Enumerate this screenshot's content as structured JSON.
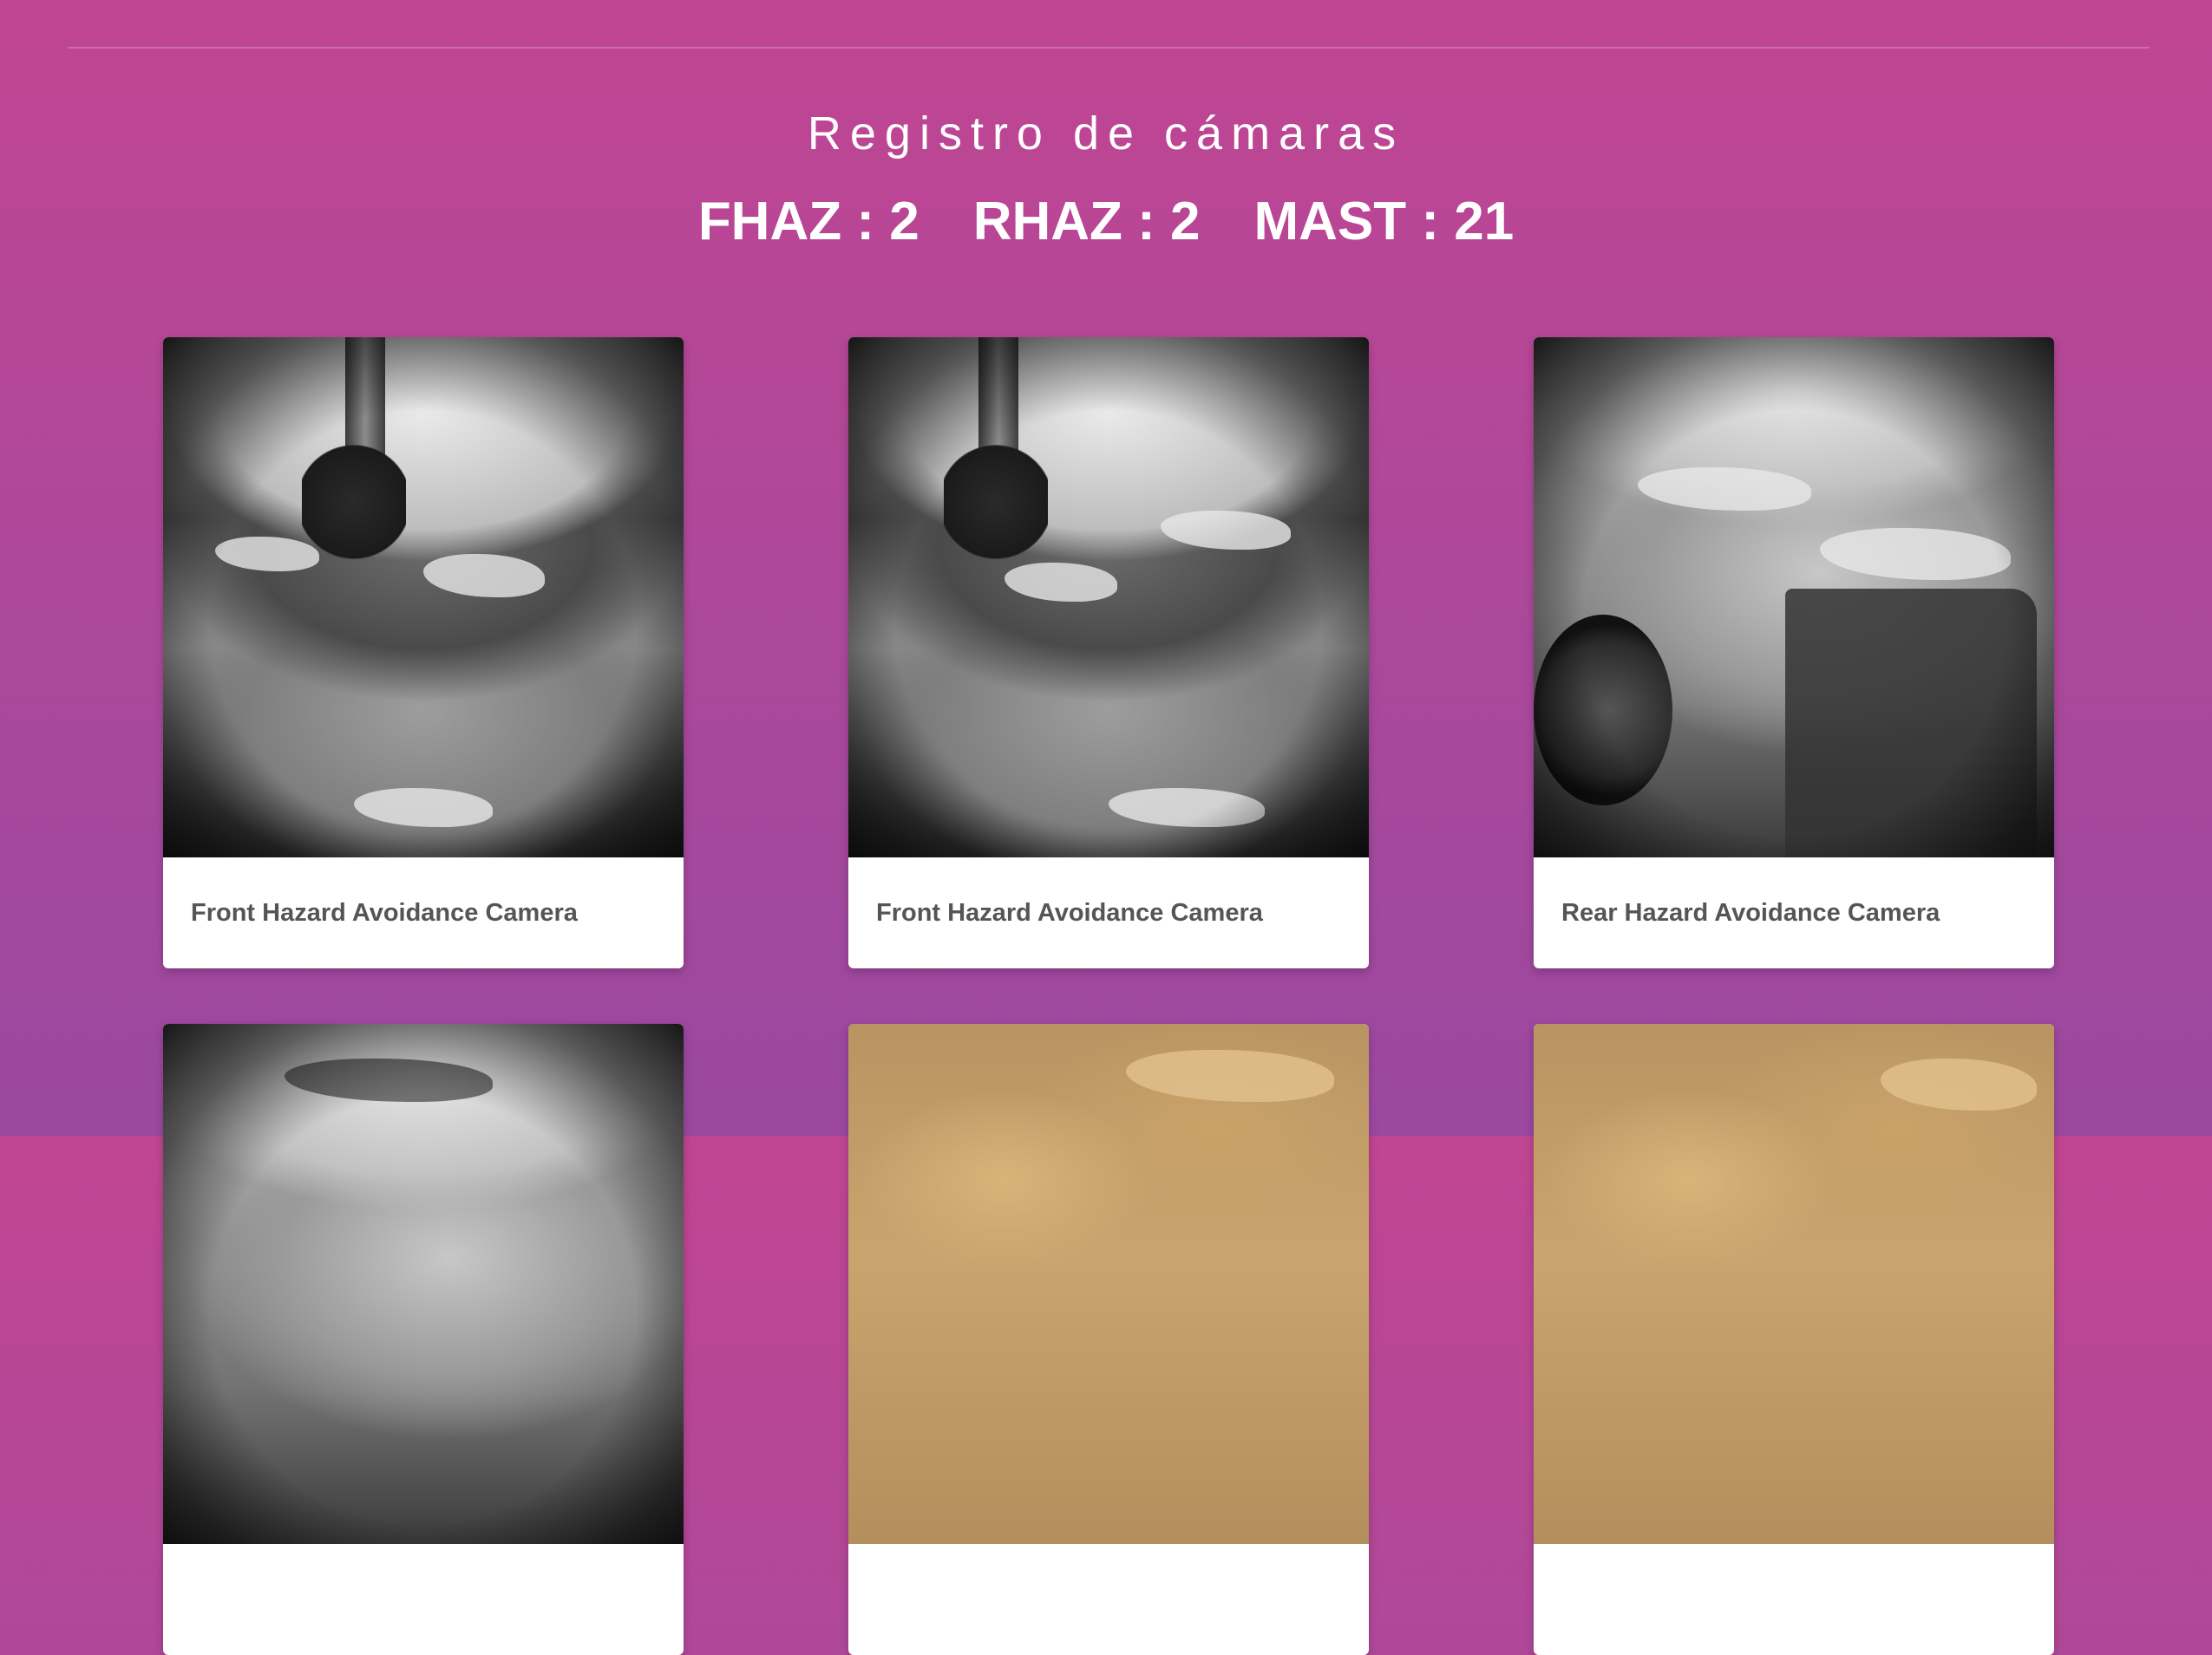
{
  "page": {
    "title": "Registro de cámaras"
  },
  "counts": [
    {
      "label": "FHAZ : 2"
    },
    {
      "label": "RHAZ : 2"
    },
    {
      "label": "MAST : 21"
    }
  ],
  "cards": [
    {
      "caption": "Front Hazard Avoidance Camera",
      "camera": "FHAZ"
    },
    {
      "caption": "Front Hazard Avoidance Camera",
      "camera": "FHAZ"
    },
    {
      "caption": "Rear Hazard Avoidance Camera",
      "camera": "RHAZ"
    },
    {
      "caption": "",
      "camera": "RHAZ"
    },
    {
      "caption": "",
      "camera": "MAST"
    },
    {
      "caption": "",
      "camera": "MAST"
    }
  ],
  "colors": {
    "background_top": "#c04592",
    "background_bottom": "#9a48a0",
    "card_background": "#ffffff",
    "caption_text": "#555555"
  }
}
